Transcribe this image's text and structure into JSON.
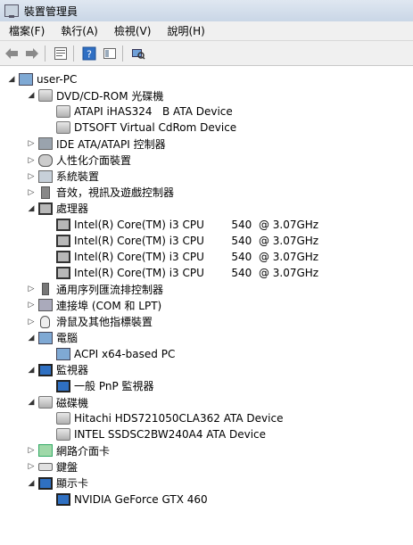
{
  "window": {
    "title": "裝置管理員"
  },
  "menu": [
    "檔案(F)",
    "執行(A)",
    "檢視(V)",
    "說明(H)"
  ],
  "toolbar": {
    "icons": [
      "back-arrow-icon",
      "forward-arrow-icon",
      "properties-icon",
      "help-icon",
      "view-icon",
      "scan-hardware-icon"
    ]
  },
  "tree": [
    {
      "label": "user-PC",
      "icon": "computer-icon",
      "level": 0,
      "expand": "expanded"
    },
    {
      "label": "DVD/CD-ROM 光碟機",
      "icon": "disc-drive-icon",
      "level": 1,
      "expand": "expanded"
    },
    {
      "label": "ATAPI iHAS324   B ATA Device",
      "icon": "disc-drive-icon",
      "level": 2,
      "expand": "none"
    },
    {
      "label": "DTSOFT Virtual CdRom Device",
      "icon": "disc-drive-icon",
      "level": 2,
      "expand": "none"
    },
    {
      "label": "IDE ATA/ATAPI 控制器",
      "icon": "ide-controller-icon",
      "level": 1,
      "expand": "collapsed"
    },
    {
      "label": "人性化介面裝置",
      "icon": "hid-icon",
      "level": 1,
      "expand": "collapsed"
    },
    {
      "label": "系統裝置",
      "icon": "system-device-icon",
      "level": 1,
      "expand": "collapsed"
    },
    {
      "label": "音效，視訊及遊戲控制器",
      "icon": "sound-icon",
      "level": 1,
      "expand": "collapsed"
    },
    {
      "label": "處理器",
      "icon": "processor-icon",
      "level": 1,
      "expand": "expanded"
    },
    {
      "label": "Intel(R) Core(TM) i3 CPU        540  @ 3.07GHz",
      "icon": "processor-icon",
      "level": 2,
      "expand": "none"
    },
    {
      "label": "Intel(R) Core(TM) i3 CPU        540  @ 3.07GHz",
      "icon": "processor-icon",
      "level": 2,
      "expand": "none"
    },
    {
      "label": "Intel(R) Core(TM) i3 CPU        540  @ 3.07GHz",
      "icon": "processor-icon",
      "level": 2,
      "expand": "none"
    },
    {
      "label": "Intel(R) Core(TM) i3 CPU        540  @ 3.07GHz",
      "icon": "processor-icon",
      "level": 2,
      "expand": "none"
    },
    {
      "label": "通用序列匯流排控制器",
      "icon": "usb-icon",
      "level": 1,
      "expand": "collapsed"
    },
    {
      "label": "連接埠 (COM 和 LPT)",
      "icon": "port-icon",
      "level": 1,
      "expand": "collapsed"
    },
    {
      "label": "滑鼠及其他指標裝置",
      "icon": "mouse-icon",
      "level": 1,
      "expand": "collapsed"
    },
    {
      "label": "電腦",
      "icon": "computer-icon",
      "level": 1,
      "expand": "expanded"
    },
    {
      "label": "ACPI x64-based PC",
      "icon": "computer-icon",
      "level": 2,
      "expand": "none"
    },
    {
      "label": "監視器",
      "icon": "monitor-icon",
      "level": 1,
      "expand": "expanded"
    },
    {
      "label": "一般 PnP 監視器",
      "icon": "monitor-icon",
      "level": 2,
      "expand": "none"
    },
    {
      "label": "磁碟機",
      "icon": "disk-drive-icon",
      "level": 1,
      "expand": "expanded"
    },
    {
      "label": "Hitachi HDS721050CLA362 ATA Device",
      "icon": "disk-drive-icon",
      "level": 2,
      "expand": "none"
    },
    {
      "label": "INTEL SSDSC2BW240A4 ATA Device",
      "icon": "disk-drive-icon",
      "level": 2,
      "expand": "none"
    },
    {
      "label": "網路介面卡",
      "icon": "network-adapter-icon",
      "level": 1,
      "expand": "collapsed"
    },
    {
      "label": "鍵盤",
      "icon": "keyboard-icon",
      "level": 1,
      "expand": "collapsed"
    },
    {
      "label": "顯示卡",
      "icon": "display-adapter-icon",
      "level": 1,
      "expand": "expanded"
    },
    {
      "label": "NVIDIA GeForce GTX 460",
      "icon": "display-adapter-icon",
      "level": 2,
      "expand": "none"
    }
  ]
}
